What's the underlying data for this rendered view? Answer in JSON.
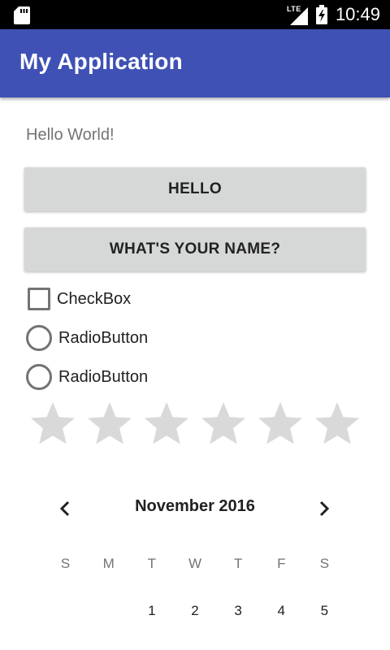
{
  "status_bar": {
    "network_label": "LTE",
    "time": "10:49",
    "icons": [
      "sd-card-icon",
      "signal-icon",
      "battery-charging-icon"
    ]
  },
  "app_bar": {
    "title": "My Application",
    "color": "#3f51b5"
  },
  "main": {
    "hello_text": "Hello World!",
    "buttons": [
      {
        "label": "HELLO"
      },
      {
        "label": "WHAT'S YOUR NAME?"
      }
    ],
    "checkbox": {
      "label": "CheckBox",
      "checked": false
    },
    "radios": [
      {
        "label": "RadioButton",
        "checked": false
      },
      {
        "label": "RadioButton",
        "checked": false
      }
    ],
    "rating": {
      "num_stars": 6,
      "value": 0
    }
  },
  "calendar": {
    "month_title": "November 2016",
    "weekdays": [
      "S",
      "M",
      "T",
      "W",
      "T",
      "F",
      "S"
    ],
    "first_week": [
      "",
      "",
      "1",
      "2",
      "3",
      "4",
      "5"
    ]
  },
  "colors": {
    "accent": "#3f51b5",
    "button_bg": "#d6d7d7",
    "star_empty": "#d9d9d9"
  }
}
